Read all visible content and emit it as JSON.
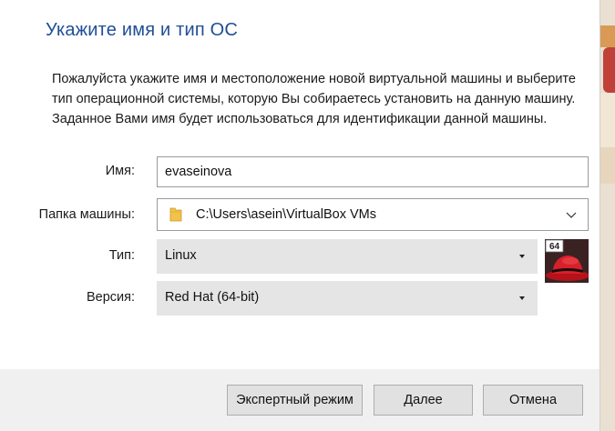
{
  "wizard": {
    "title": "Укажите имя и тип ОС",
    "description": "Пожалуйста укажите имя и местоположение новой виртуальной машины и выберите тип операционной системы, которую Вы собираетесь установить на данную машину. Заданное Вами имя будет использоваться для идентификации данной машины."
  },
  "form": {
    "name_label": "Имя:",
    "name_value": "evaseinova",
    "folder_label": "Папка машины:",
    "folder_value": "C:\\Users\\asein\\VirtualBox VMs",
    "type_label": "Тип:",
    "type_value": "Linux",
    "version_label": "Версия:",
    "version_value": "Red Hat (64-bit)",
    "os_icon_badge": "64",
    "os_icon": "redhat-64-icon"
  },
  "buttons": {
    "expert": "Экспертный режим",
    "next": "Далее",
    "cancel": "Отмена"
  },
  "colors": {
    "title": "#1f4e96",
    "footer_bg": "#f0f0f0",
    "select_bg": "#e5e5e5"
  }
}
